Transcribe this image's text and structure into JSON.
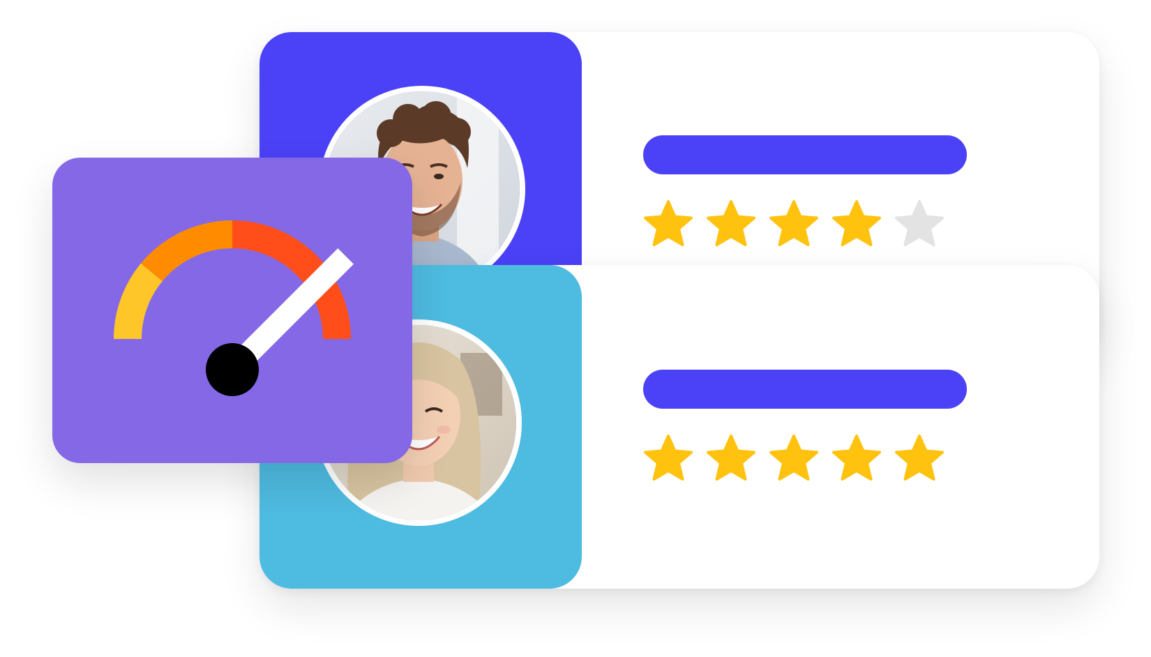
{
  "colors": {
    "accent": "#4B41F6",
    "card1_panel": "#4B41F6",
    "card2_panel": "#4EBBE0",
    "gauge_card": "#8568E6",
    "star_filled": "#FFC20E",
    "star_empty": "#E3E3E3",
    "gauge_segments": [
      "#FFC629",
      "#FF8C00",
      "#FF4E1A"
    ],
    "needle": "#FFFFFF",
    "needle_hub": "#000000"
  },
  "reviews": [
    {
      "avatar": "man-smiling-avatar",
      "rating": 4,
      "max_rating": 5
    },
    {
      "avatar": "woman-smiling-avatar",
      "rating": 5,
      "max_rating": 5
    }
  ],
  "gauge": {
    "icon": "speedometer-icon",
    "level": 0.75
  }
}
